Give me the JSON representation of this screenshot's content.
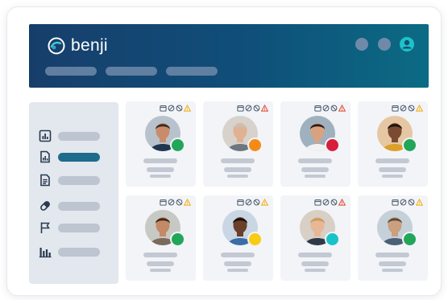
{
  "app": {
    "brand_name": "benji"
  },
  "header": {
    "nav_items": [
      "",
      "",
      ""
    ],
    "icons": [
      "circle-icon",
      "circle-icon",
      "user-icon"
    ]
  },
  "sidebar": {
    "items": [
      {
        "icon": "report-icon",
        "label": ""
      },
      {
        "icon": "chart-document-icon",
        "label": "",
        "active": true
      },
      {
        "icon": "document-icon",
        "label": ""
      },
      {
        "icon": "pill-icon",
        "label": ""
      },
      {
        "icon": "flag-icon",
        "label": ""
      },
      {
        "icon": "bar-chart-icon",
        "label": ""
      }
    ]
  },
  "patients": [
    {
      "status_color": "#22a65a",
      "alert_color": "#f2b21b"
    },
    {
      "status_color": "#f58a17",
      "alert_color": "#e25238"
    },
    {
      "status_color": "#d71e3d",
      "alert_color": "#e25238"
    },
    {
      "status_color": "#22a65a",
      "alert_color": "#f2b21b"
    },
    {
      "status_color": "#22a65a",
      "alert_color": "#f2b21b"
    },
    {
      "status_color": "#f7cc12",
      "alert_color": "#f2b21b"
    },
    {
      "status_color": "#18c3c8",
      "alert_color": "#e25238"
    },
    {
      "status_color": "#22a65a",
      "alert_color": "#f2b21b"
    }
  ],
  "colors": {
    "header_gradient": [
      "#173e6b",
      "#0b6b84"
    ],
    "active_nav": "#1d6c8b",
    "card_bg": "#f2f4f8"
  }
}
